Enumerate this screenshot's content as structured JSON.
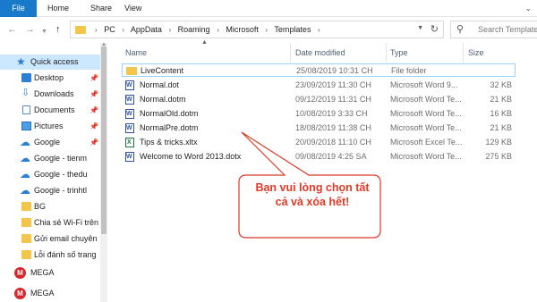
{
  "ribbon": {
    "tabs": [
      "File",
      "Home",
      "Share",
      "View"
    ]
  },
  "address": {
    "crumbs": [
      "PC",
      "AppData",
      "Roaming",
      "Microsoft",
      "Templates"
    ]
  },
  "search": {
    "placeholder": "Search Templates"
  },
  "sidebar": {
    "items": [
      {
        "label": "Quick access",
        "icon": "star-icon",
        "active": true
      },
      {
        "label": "Desktop",
        "icon": "desktop-icon",
        "pinned": true
      },
      {
        "label": "Downloads",
        "icon": "download-icon",
        "pinned": true
      },
      {
        "label": "Documents",
        "icon": "documents-icon",
        "pinned": true
      },
      {
        "label": "Pictures",
        "icon": "pictures-icon",
        "pinned": true
      },
      {
        "label": "Google",
        "icon": "cloud-icon",
        "pinned": true
      },
      {
        "label": "Google - tienm",
        "icon": "cloud-icon"
      },
      {
        "label": "Google - thedu",
        "icon": "cloud-icon"
      },
      {
        "label": "Google - trinhtl",
        "icon": "cloud-icon"
      },
      {
        "label": "BG",
        "icon": "folder-icon"
      },
      {
        "label": "Chia sẻ Wi-Fi trên",
        "icon": "folder-icon"
      },
      {
        "label": "Gửi email chuyên",
        "icon": "folder-icon"
      },
      {
        "label": "Lỗi đánh số trang",
        "icon": "folder-icon"
      },
      {
        "label": "MEGA",
        "icon": "mega-icon"
      },
      {
        "label": "MEGA",
        "icon": "mega-icon"
      }
    ]
  },
  "columns": {
    "name": "Name",
    "date": "Date modified",
    "type": "Type",
    "size": "Size"
  },
  "files": [
    {
      "name": "LiveContent",
      "date": "25/08/2019 10:31 CH",
      "type": "File folder",
      "size": "",
      "icon": "folder"
    },
    {
      "name": "Normal.dot",
      "date": "23/09/2019 11:30 CH",
      "type": "Microsoft Word 9...",
      "size": "32 KB",
      "icon": "word"
    },
    {
      "name": "Normal.dotm",
      "date": "09/12/2019 11:31 CH",
      "type": "Microsoft Word Te...",
      "size": "21 KB",
      "icon": "word"
    },
    {
      "name": "NormalOld.dotm",
      "date": "10/08/2019 3:33 CH",
      "type": "Microsoft Word Te...",
      "size": "16 KB",
      "icon": "word"
    },
    {
      "name": "NormalPre.dotm",
      "date": "18/08/2019 11:38 CH",
      "type": "Microsoft Word Te...",
      "size": "21 KB",
      "icon": "word"
    },
    {
      "name": "Tips & tricks.xltx",
      "date": "20/09/2018 11:10 CH",
      "type": "Microsoft Excel Te...",
      "size": "129 KB",
      "icon": "excel"
    },
    {
      "name": "Welcome to Word 2013.dotx",
      "date": "09/08/2019 4:25 SA",
      "type": "Microsoft Word Te...",
      "size": "275 KB",
      "icon": "word"
    }
  ],
  "callout": {
    "line1": "Bạn vui lòng chọn tất",
    "line2": "cả và xóa hết!",
    "color": "#e23a26"
  }
}
